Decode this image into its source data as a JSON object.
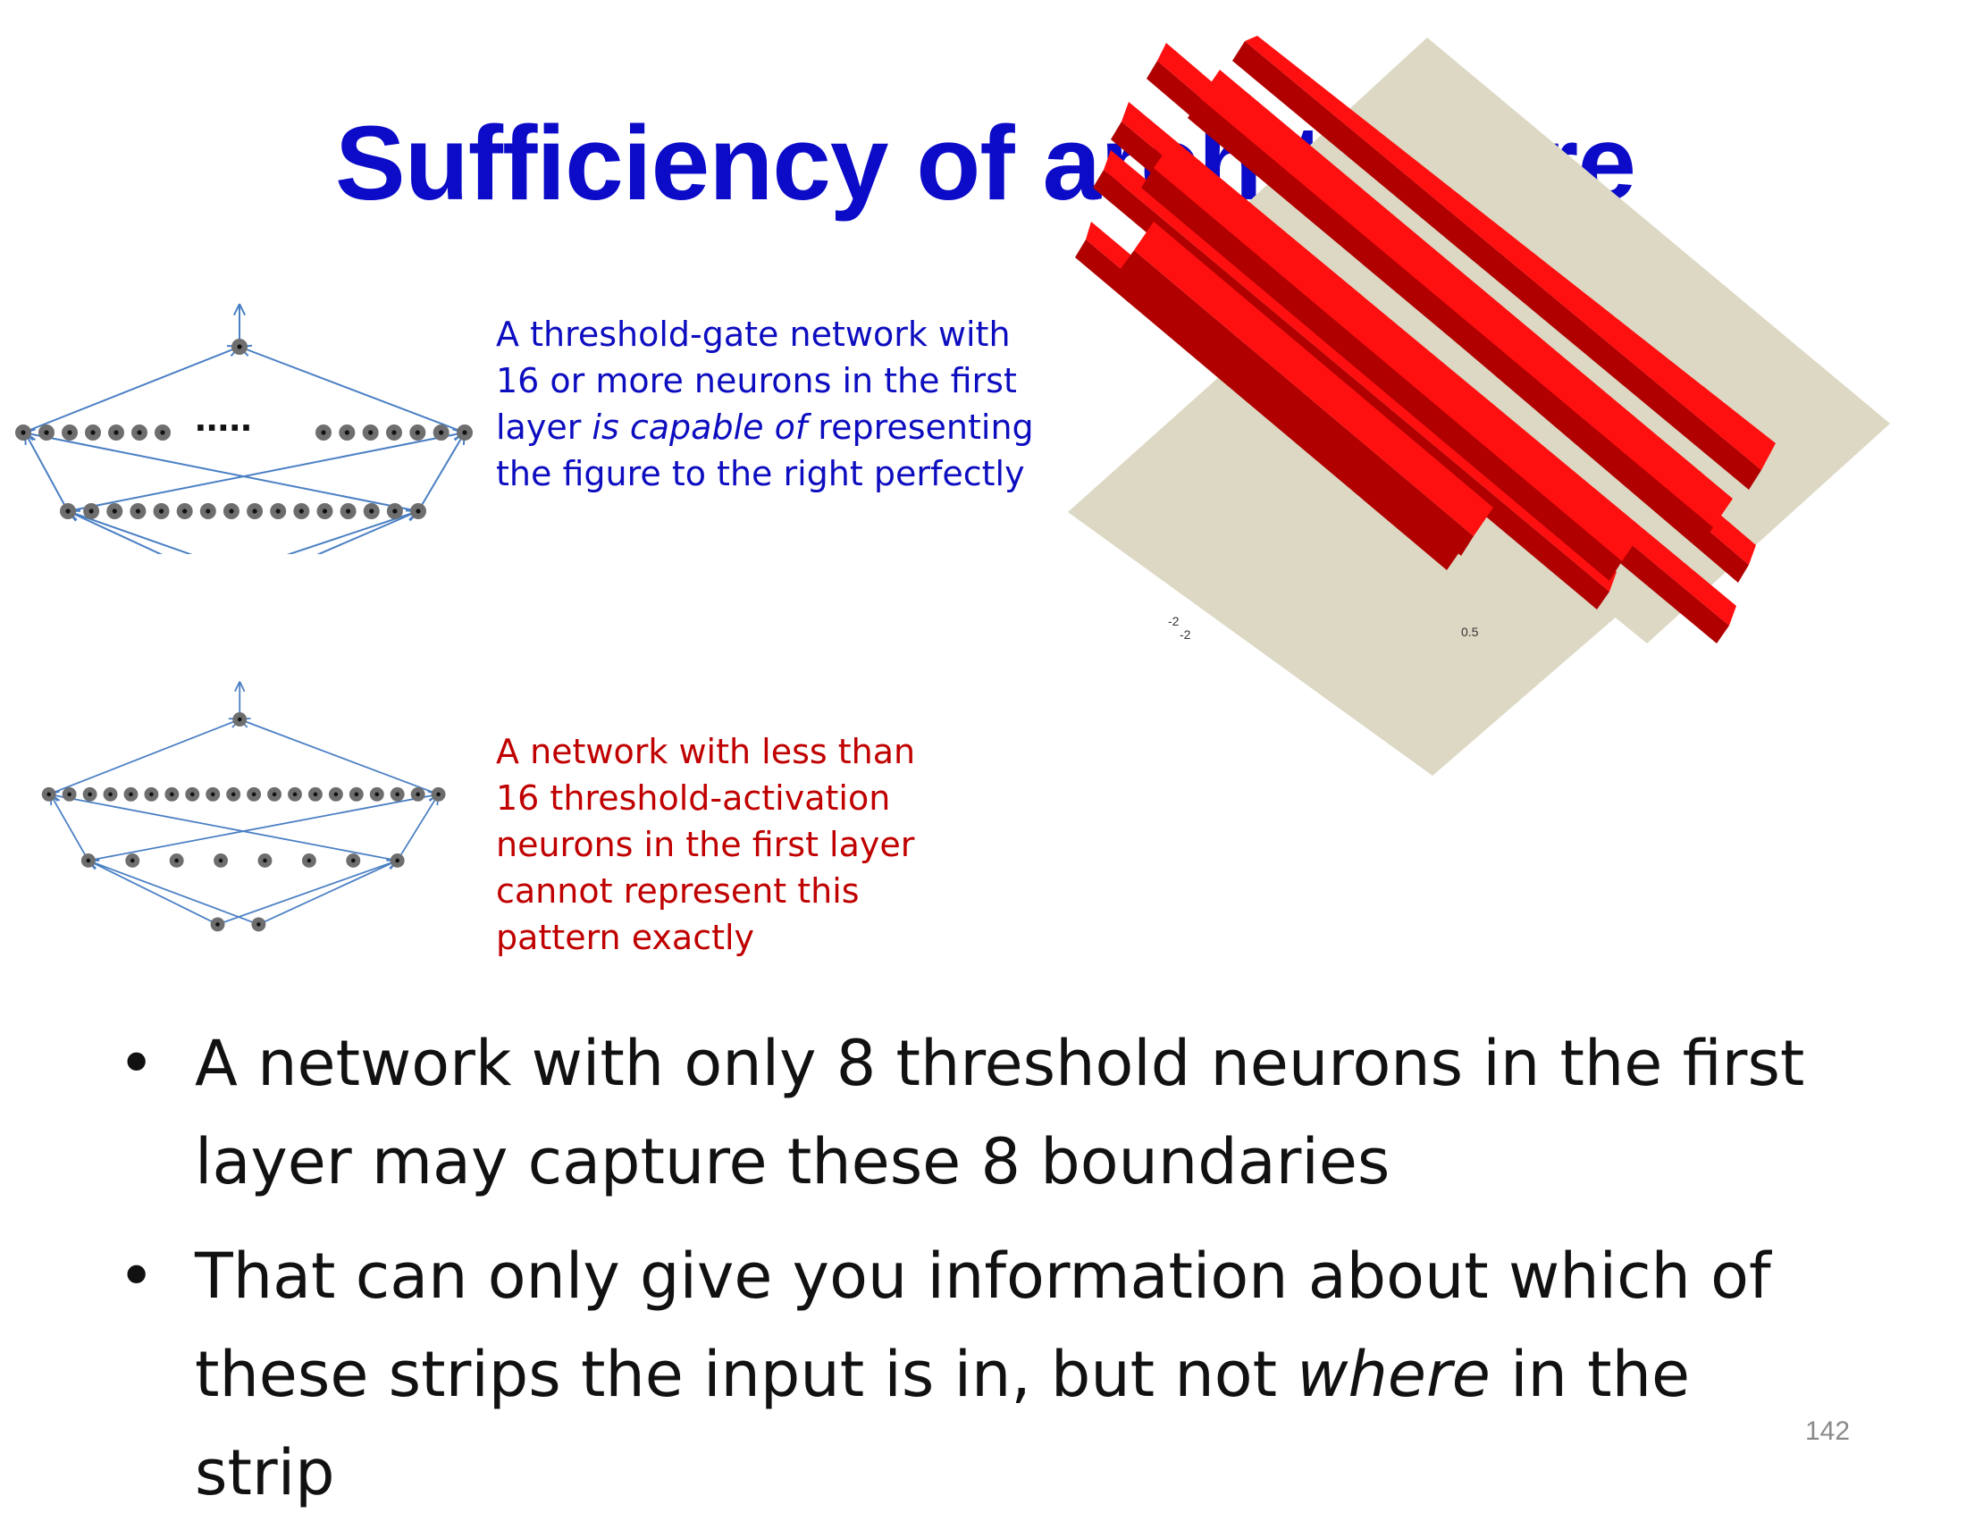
{
  "title": "Sufficiency of architecture",
  "caption_top": {
    "lines": [
      "A threshold-gate network with",
      "16 or more neurons  in the first"
    ],
    "line3_before": "layer ",
    "line3_italic": "is capable of",
    "line3_after": " representing",
    "line4": "the figure to the right perfectly",
    "color": "#0d0dc0"
  },
  "caption_bottom": {
    "text": "A network with less than\n16 threshold-activation\nneurons  in the first layer\ncannot represent this\npattern exactly",
    "color": "#c00000"
  },
  "network_top": {
    "ellipsis": ".....",
    "input_nodes": 2,
    "first_layer_nodes": 16,
    "second_layer_left_nodes": 7,
    "second_layer_right_nodes": 7,
    "output_nodes": 1
  },
  "network_bottom": {
    "input_nodes": 2,
    "first_layer_nodes": 8,
    "second_layer_nodes": 20,
    "output_nodes": 1
  },
  "plot_ticks": [
    "-2",
    "-2",
    "0.5"
  ],
  "bullets": [
    {
      "text": "A network with only 8 threshold neurons in the first layer may capture these 8 boundaries"
    },
    {
      "before": "That can only give you information about which of these strips the input is in, but not ",
      "italic": "where",
      "after": " in the strip"
    }
  ],
  "bullet_symbol": "•",
  "page_number": "142",
  "colors": {
    "title": "#0b0bc8",
    "plane": "#dcd8c3",
    "strip": "#ff1010",
    "strip_dark": "#b00000",
    "edge": "#4a7fc4",
    "node": "#6e6e6e"
  }
}
